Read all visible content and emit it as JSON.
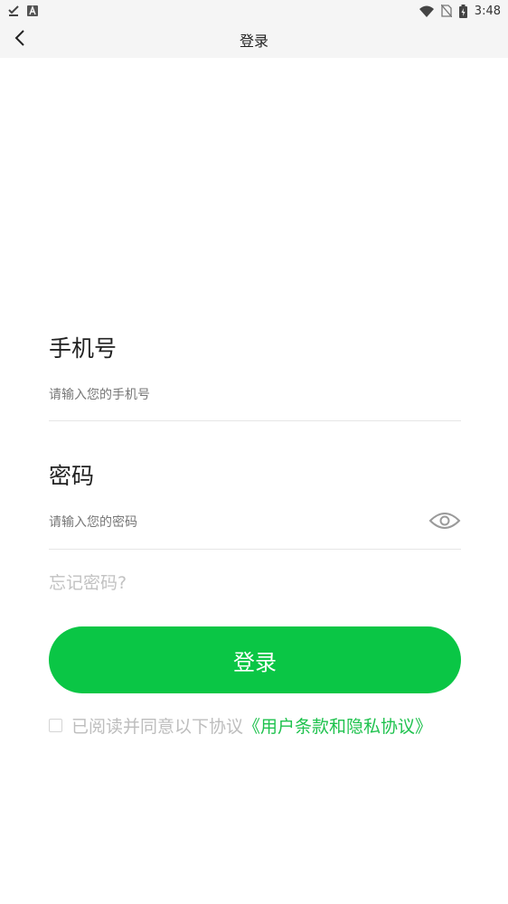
{
  "status_bar": {
    "time": "3:48",
    "icons_left": [
      "check-download-icon",
      "a-notification-icon"
    ],
    "icons_right": [
      "wifi-icon",
      "no-sim-icon",
      "battery-charging-icon"
    ]
  },
  "app_bar": {
    "back_icon": "chevron-left-icon",
    "title": "登录"
  },
  "phone": {
    "label": "手机号",
    "placeholder": "请输入您的手机号",
    "value": ""
  },
  "password": {
    "label": "密码",
    "placeholder": "请输入您的密码",
    "value": "",
    "toggle_icon": "eye-icon"
  },
  "forgot_password": "忘记密码?",
  "login_button": "登录",
  "agreement": {
    "checked": false,
    "text": "已阅读并同意以下协议",
    "link": "《用户条款和隐私协议》"
  },
  "colors": {
    "accent": "#0ac645",
    "link": "#1fc24e",
    "bar_bg": "#f5f5f5"
  }
}
